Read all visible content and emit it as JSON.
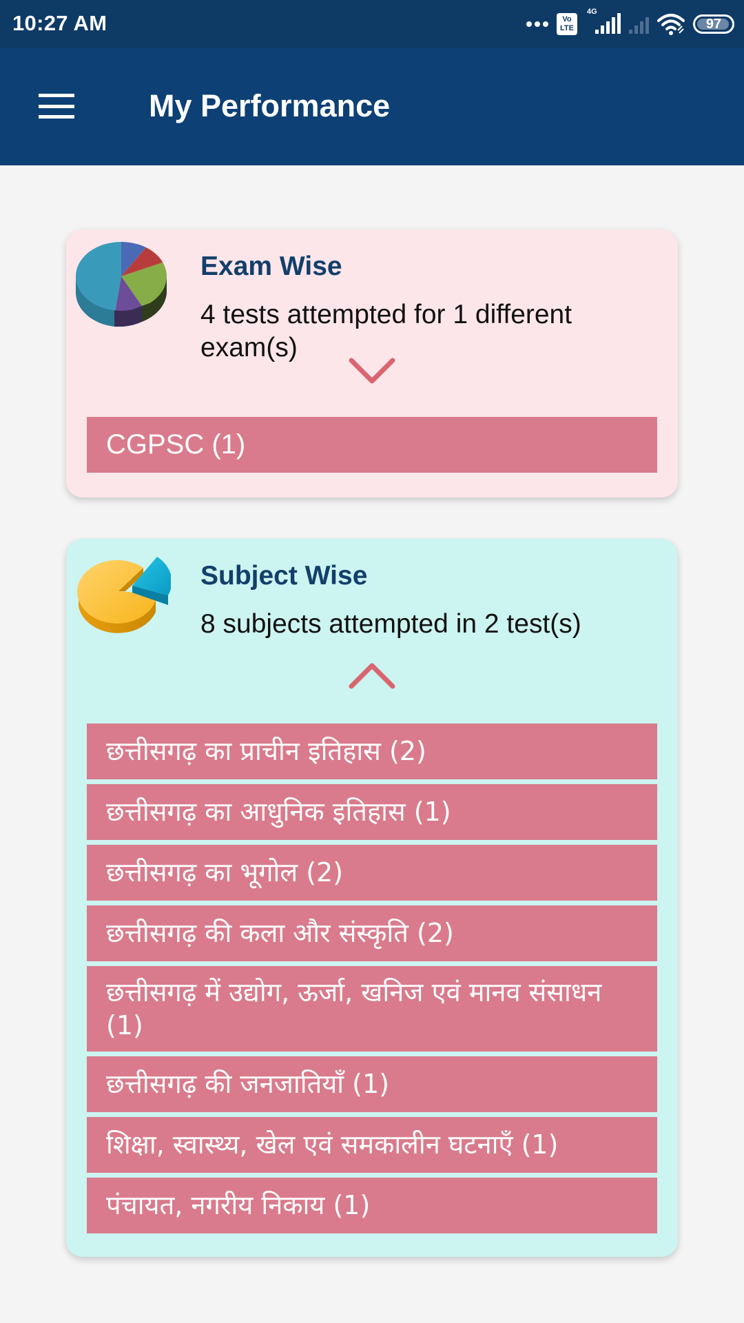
{
  "status_bar": {
    "time": "10:27 AM",
    "volte_label": "Vo LTE",
    "network_label": "4G",
    "battery": "97",
    "battery_level_percent": 97,
    "icons": [
      "more-dots-icon",
      "volte-icon",
      "signal-4g-icon",
      "signal-no-service-icon",
      "wifi-icon",
      "battery-icon"
    ]
  },
  "app_bar": {
    "menu_icon": "hamburger-menu-icon",
    "title": "My Performance"
  },
  "colors": {
    "status_bar": "#0e3a66",
    "app_bar": "#0d4074",
    "background": "#f4f4f4",
    "exam_card": "#fde6ea",
    "subject_card": "#ccf4f1",
    "list_item": "#d97b8c",
    "card_title": "#123f6b",
    "chevron": "#d9656f"
  },
  "exam_wise": {
    "icon": "multicolor-pie-chart-icon",
    "title": "Exam Wise",
    "summary": "4 tests attempted for 1 different exam(s)",
    "toggle_icon": "chevron-down-icon",
    "items": [
      {
        "label": "CGPSC (1)"
      }
    ]
  },
  "subject_wise": {
    "icon": "orange-pie-chart-icon",
    "title": "Subject Wise",
    "summary": "8 subjects attempted in 2 test(s)",
    "toggle_icon": "chevron-up-icon",
    "items": [
      {
        "label": "छत्तीसगढ़ का प्राचीन इतिहास (2)"
      },
      {
        "label": "छत्तीसगढ़ का आधुनिक इतिहास (1)"
      },
      {
        "label": "छत्तीसगढ़ का भूगोल (2)"
      },
      {
        "label": "छत्तीसगढ़ की कला और संस्कृति (2)"
      },
      {
        "label": "छत्तीसगढ़ में उद्योग, ऊर्जा, खनिज एवं मानव संसाधन (1)"
      },
      {
        "label": "छत्तीसगढ़ की जनजातियाँ (1)"
      },
      {
        "label": "शिक्षा, स्वास्थ्य, खेल एवं समकालीन घटनाएँ (1)"
      },
      {
        "label": "पंचायत, नगरीय निकाय (1)"
      }
    ]
  }
}
